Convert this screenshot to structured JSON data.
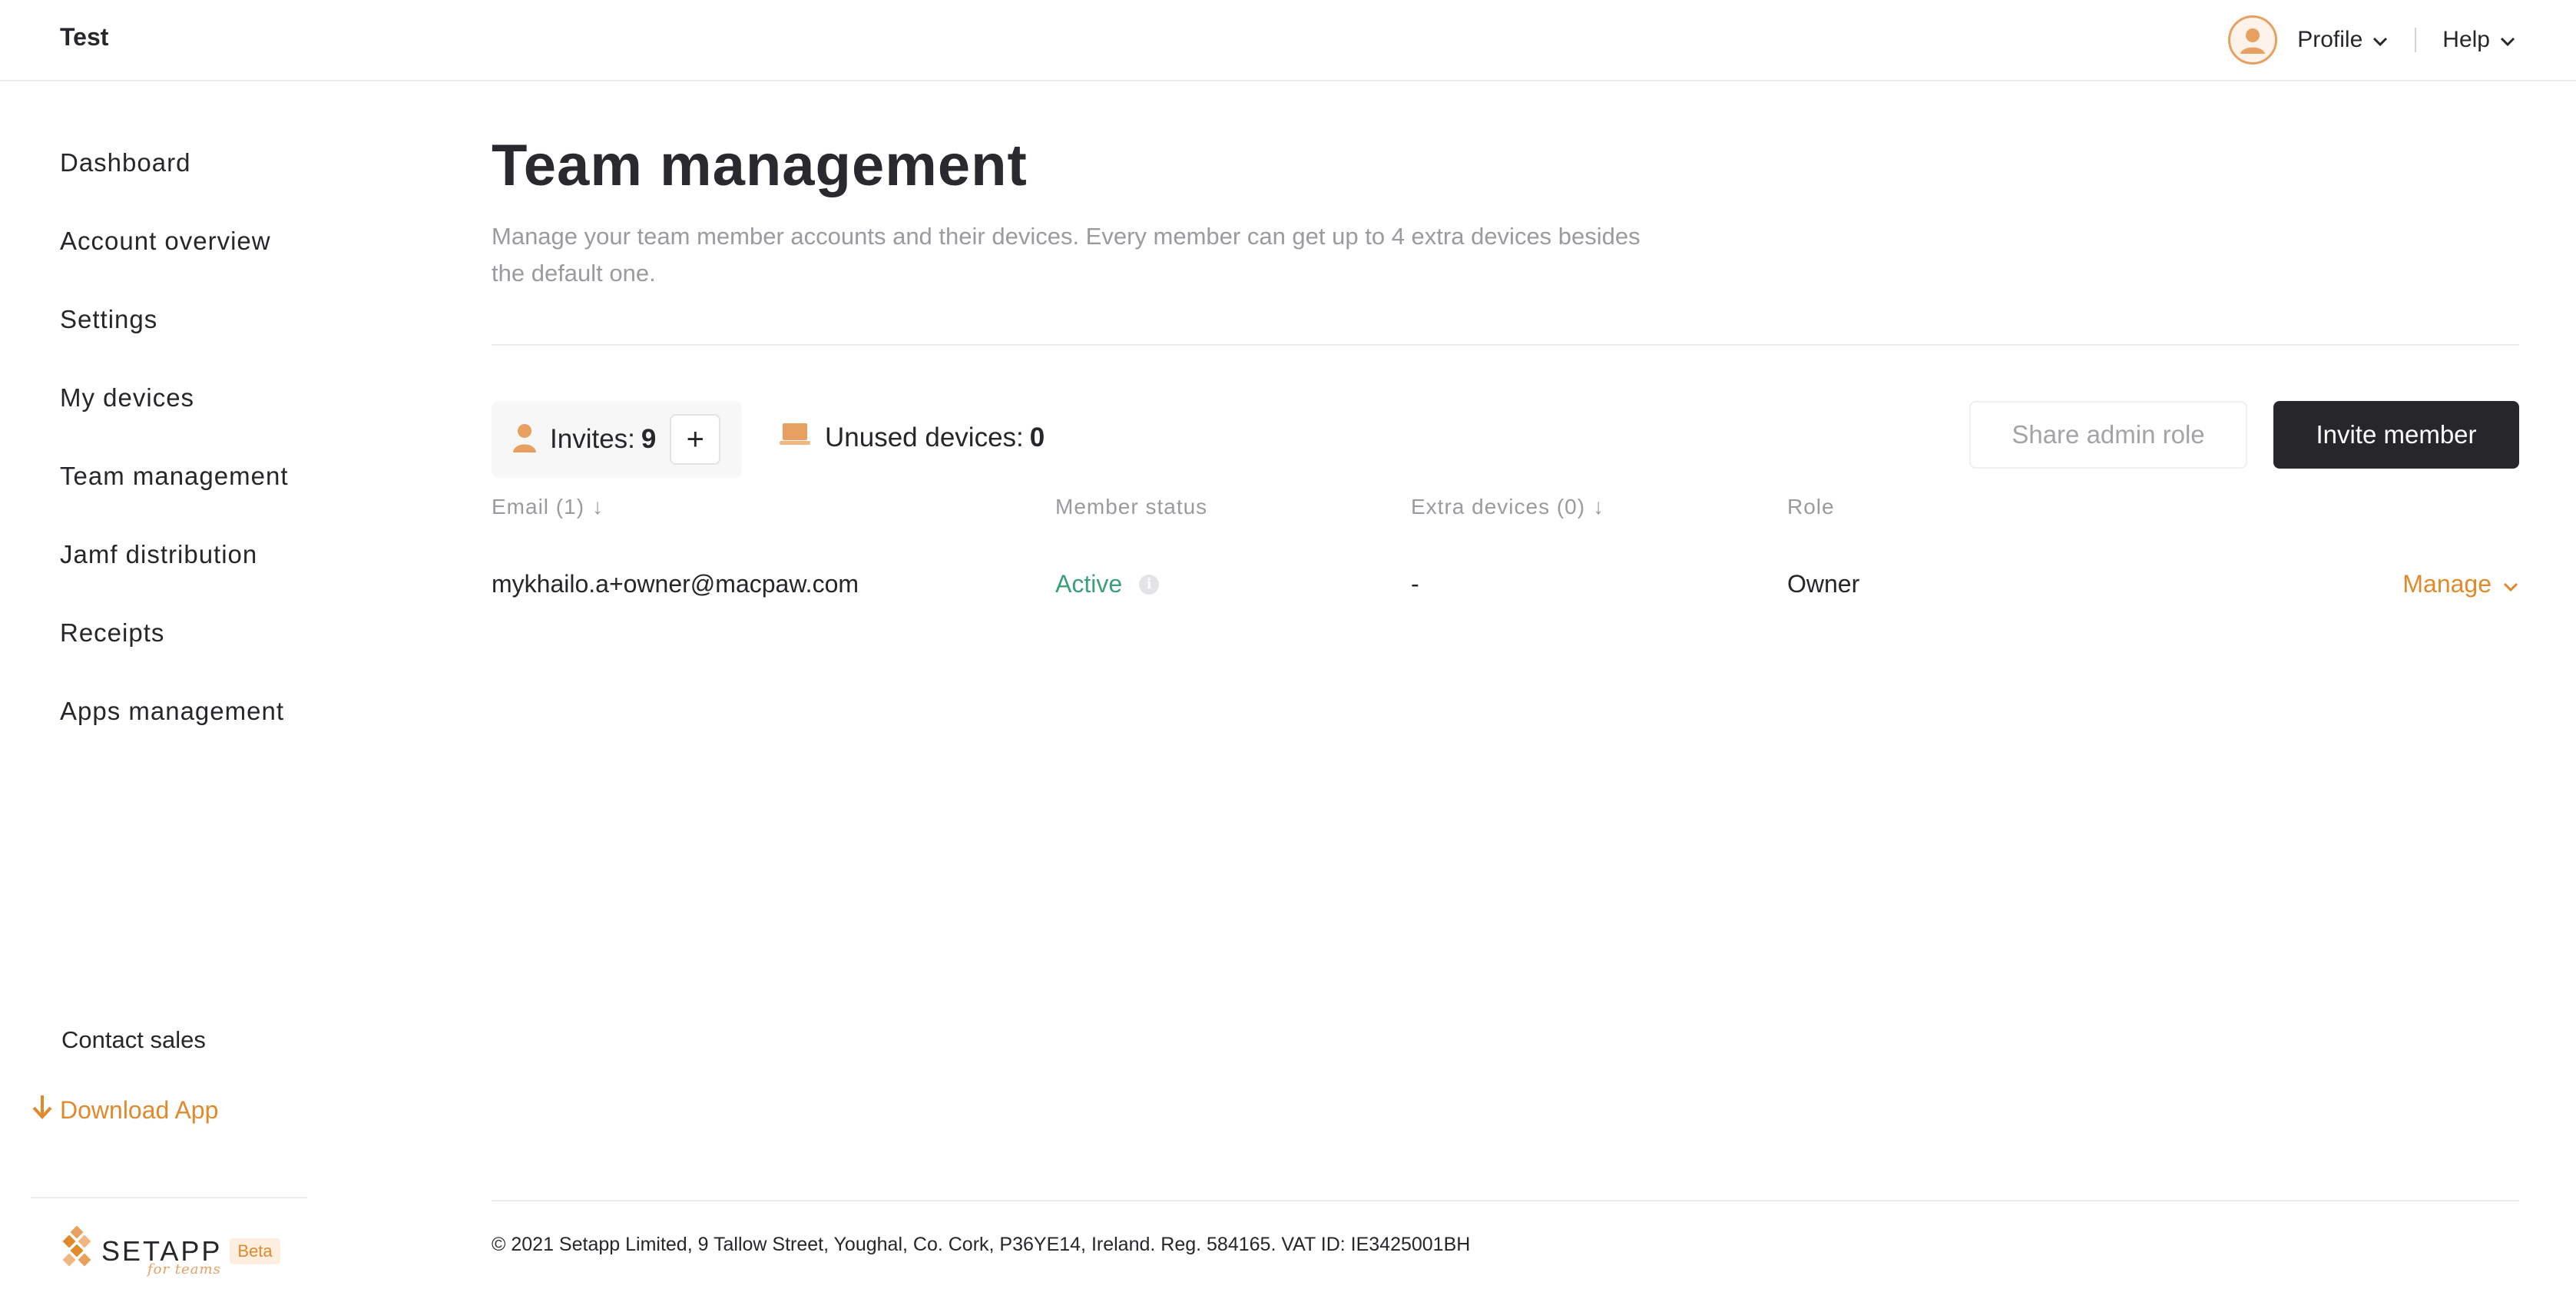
{
  "header": {
    "brand": "Test",
    "profile_label": "Profile",
    "help_label": "Help"
  },
  "sidebar": {
    "items": [
      {
        "label": "Dashboard"
      },
      {
        "label": "Account overview"
      },
      {
        "label": "Settings"
      },
      {
        "label": "My devices"
      },
      {
        "label": "Team management"
      },
      {
        "label": "Jamf distribution"
      },
      {
        "label": "Receipts"
      },
      {
        "label": "Apps management"
      }
    ],
    "contact_sales": "Contact sales",
    "download_app": "Download App",
    "logo": {
      "text": "SETAPP",
      "subtext": "for teams",
      "badge": "Beta"
    }
  },
  "main": {
    "title": "Team management",
    "description": "Manage your team member accounts and their devices. Every member can get up to 4 extra devices besides the default one.",
    "invites": {
      "label": "Invites:",
      "count": "9",
      "add_symbol": "+"
    },
    "unused_devices": {
      "label": "Unused devices:",
      "count": "0"
    },
    "share_admin_role": "Share admin role",
    "invite_member": "Invite member",
    "table": {
      "columns": [
        {
          "label": "Email (1)",
          "sort": "↓"
        },
        {
          "label": "Member status"
        },
        {
          "label": "Extra devices (0)",
          "sort": "↓"
        },
        {
          "label": "Role"
        }
      ],
      "rows": [
        {
          "email": "mykhailo.a+owner@macpaw.com",
          "status": "Active",
          "extra_devices": "-",
          "role": "Owner",
          "action": "Manage"
        }
      ]
    }
  },
  "footer": {
    "text": "© 2021 Setapp Limited, 9 Tallow Street, Youghal, Co. Cork, P36YE14, Ireland. Reg. 584165. VAT ID: IE3425001BH"
  },
  "colors": {
    "accent": "#e08a2e",
    "active_status": "#3d9e7a",
    "dark_button": "#26262b"
  },
  "icons": {
    "avatar": "user-avatar-icon",
    "invites": "person-icon",
    "unused_devices": "laptop-icon",
    "download": "arrow-down-icon",
    "info": "info-icon",
    "logo": "setapp-diamond-icon"
  }
}
